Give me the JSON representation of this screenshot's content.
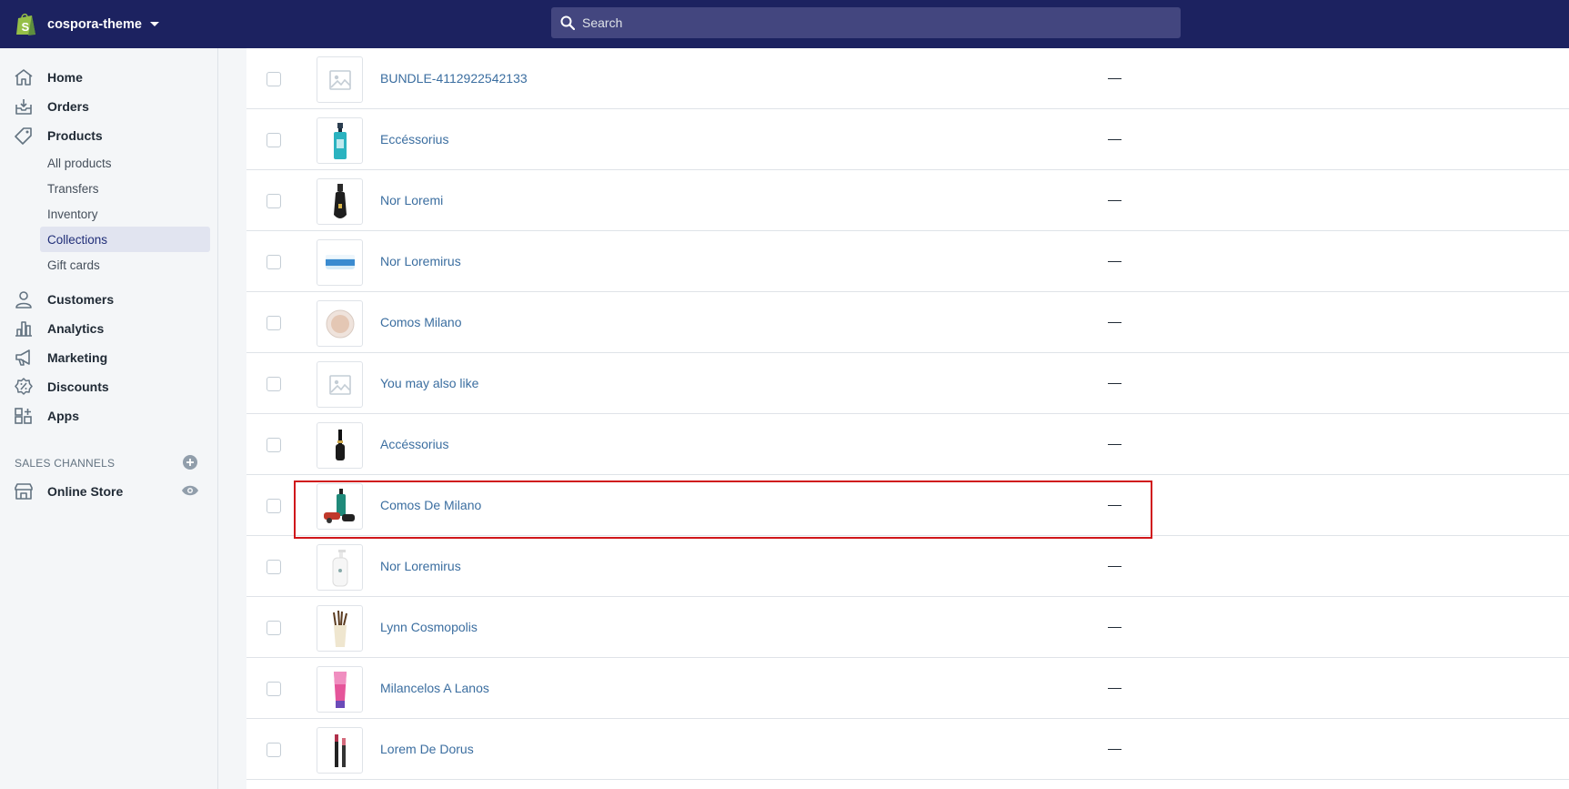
{
  "store": {
    "name": "cospora-theme"
  },
  "search": {
    "placeholder": "Search"
  },
  "nav": {
    "home": "Home",
    "orders": "Orders",
    "products": "Products",
    "products_sub": {
      "all_products": "All products",
      "transfers": "Transfers",
      "inventory": "Inventory",
      "collections": "Collections",
      "gift_cards": "Gift cards"
    },
    "customers": "Customers",
    "analytics": "Analytics",
    "marketing": "Marketing",
    "discounts": "Discounts",
    "apps": "Apps"
  },
  "sales_channels": {
    "heading": "SALES CHANNELS",
    "online_store": "Online Store"
  },
  "collections": [
    {
      "title": "BUNDLE-4112922542133",
      "conditions": "—",
      "thumb": "placeholder-image-icon"
    },
    {
      "title": "Eccéssorius",
      "conditions": "—",
      "thumb": "teal-pump-bottle"
    },
    {
      "title": "Nor Loremi",
      "conditions": "—",
      "thumb": "black-perfume-bottle"
    },
    {
      "title": "Nor Loremirus",
      "conditions": "—",
      "thumb": "blue-cream-jar"
    },
    {
      "title": "Comos Milano",
      "conditions": "—",
      "thumb": "powder-compact"
    },
    {
      "title": "You may also like",
      "conditions": "—",
      "thumb": "placeholder-image-icon"
    },
    {
      "title": "Accéssorius",
      "conditions": "—",
      "thumb": "black-nail-polish"
    },
    {
      "title": "Comos De Milano",
      "conditions": "—",
      "thumb": "teal-bottle-set"
    },
    {
      "title": "Nor Loremirus",
      "conditions": "—",
      "thumb": "white-lotion-bottle"
    },
    {
      "title": "Lynn Cosmopolis",
      "conditions": "—",
      "thumb": "brush-holder"
    },
    {
      "title": "Milancelos A Lanos",
      "conditions": "—",
      "thumb": "pink-tube"
    },
    {
      "title": "Lorem De Dorus",
      "conditions": "—",
      "thumb": "lipstick-pair"
    }
  ],
  "colors": {
    "topbar": "#1c2260",
    "search_bg": "#43467f",
    "link": "#3b6ea0",
    "active_nav_bg": "#e1e4f0",
    "highlight": "#d0171b"
  }
}
